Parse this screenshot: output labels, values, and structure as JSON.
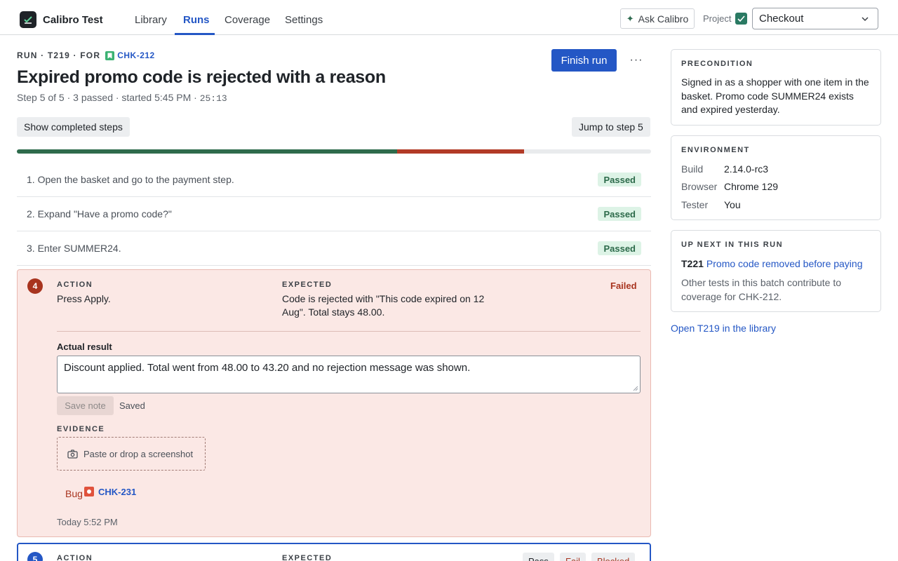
{
  "app": {
    "name": "Calibro Test"
  },
  "nav": {
    "tabs": [
      "Library",
      "Runs",
      "Coverage",
      "Settings"
    ],
    "active": "Runs"
  },
  "header_actions": {
    "ask_label": "Ask Calibro",
    "project_label": "Project",
    "project_value": "Checkout"
  },
  "run": {
    "meta_prefix": "RUN · T219 · FOR",
    "story_key": "CHK-212",
    "title": "Expired promo code is rejected with a reason",
    "subline": "Step 5 of 5 · 3 passed · started 5:45 PM · ",
    "elapsed": "25:13",
    "finish_label": "Finish run",
    "more_label": "···",
    "show_completed_label": "Show completed steps",
    "jump_label": "Jump to step 5",
    "progress": {
      "passed_fraction": 0.6,
      "failed_fraction": 0.2
    }
  },
  "steps": [
    {
      "text": "1. Open the basket and go to the payment step.",
      "status": "Passed"
    },
    {
      "text": "2. Expand \"Have a promo code?\"",
      "status": "Passed"
    },
    {
      "text": "3. Enter SUMMER24.",
      "status": "Passed"
    }
  ],
  "failed_step": {
    "number": "4",
    "action_label": "ACTION",
    "action": "Press Apply.",
    "expected_label": "EXPECTED",
    "expected": "Code is rejected with \"This code expired on 12 Aug\". Total stays 48.00.",
    "status": "Failed",
    "actual_label": "Actual result",
    "actual": "Discount applied. Total went from 48.00 to 43.20 and no rejection message was shown.",
    "save_label": "Save note",
    "saved_label": "Saved",
    "evidence_label": "EVIDENCE",
    "drop_label": "Paste or drop a screenshot",
    "bug_label": "Bug",
    "bug_key": "CHK-231",
    "timestamp": "Today 5:52 PM"
  },
  "active_step": {
    "number": "5",
    "action_label": "ACTION",
    "expected_label": "EXPECTED",
    "pass_label": "Pass",
    "fail_label": "Fail",
    "blocked_label": "Blocked"
  },
  "sidebar": {
    "precondition": {
      "title": "PRECONDITION",
      "text": "Signed in as a shopper with one item in the basket. Promo code SUMMER24 exists and expired yesterday."
    },
    "environment": {
      "title": "ENVIRONMENT",
      "rows": [
        {
          "key": "Build",
          "value": "2.14.0-rc3"
        },
        {
          "key": "Browser",
          "value": "Chrome 129"
        },
        {
          "key": "Tester",
          "value": "You"
        }
      ]
    },
    "up_next": {
      "title": "UP NEXT IN THIS RUN",
      "id": "T221",
      "link": "Promo code removed before paying",
      "note": "Other tests in this batch contribute to coverage for CHK-212."
    },
    "open_link": "Open T219 in the library"
  },
  "colors": {
    "accent": "#2457c5",
    "passed": "#2e6b4c",
    "failed": "#b23b27",
    "fail_bg": "#fbe8e5"
  }
}
